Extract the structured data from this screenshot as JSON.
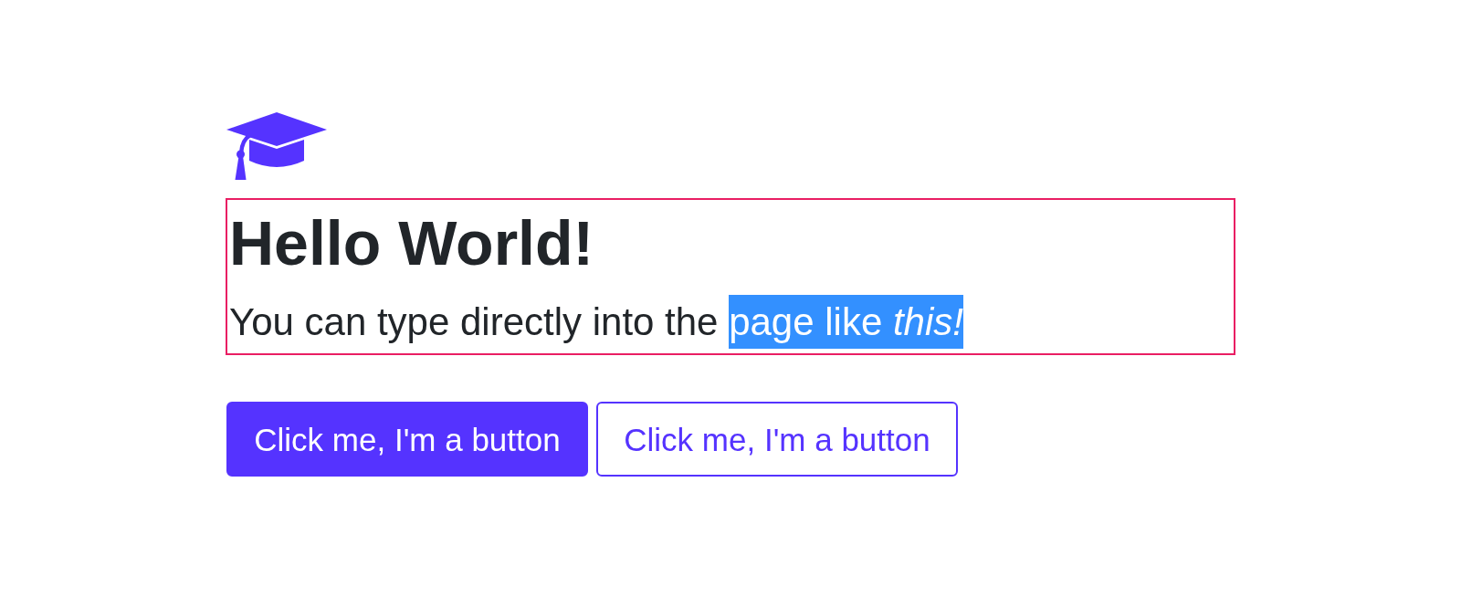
{
  "editor": {
    "focused": true,
    "heading": "Hello World!",
    "paragraph": [
      {
        "text": "You can type directly into the ",
        "selected": false
      },
      {
        "text": "page like *this!*",
        "selected": true
      }
    ]
  },
  "buttons": [
    {
      "label": "Click me, I'm a button",
      "kind": "primary"
    },
    {
      "label": "Click me, I'm a button",
      "kind": "outline"
    }
  ]
}
